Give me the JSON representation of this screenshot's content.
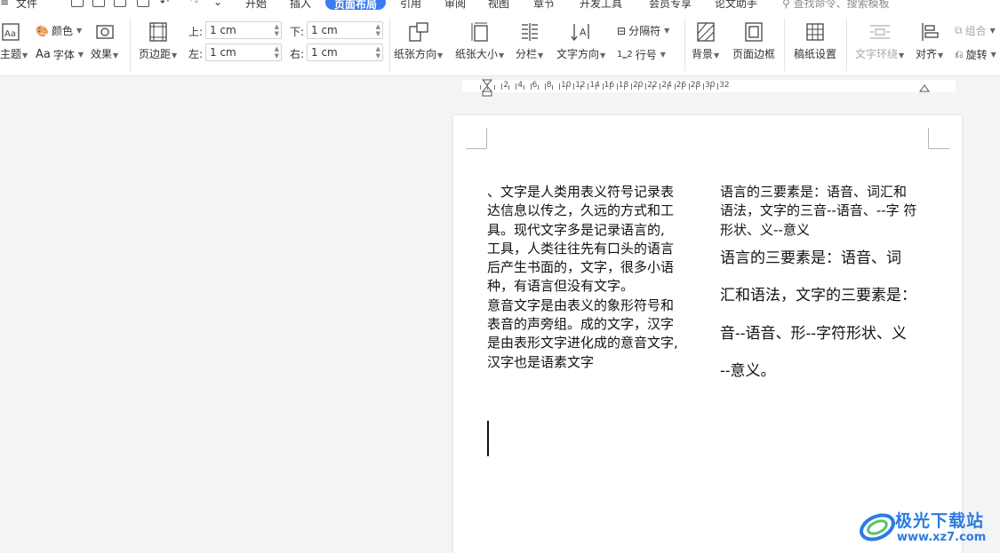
{
  "menubar": {
    "file": "文件",
    "tabs": [
      "开始",
      "插入",
      "页面布局",
      "引用",
      "审阅",
      "视图",
      "章节",
      "开发工具",
      "会员专享",
      "论文助手"
    ],
    "active_tab": "页面布局",
    "search_placeholder": "查找命令、搜索模板"
  },
  "ribbon": {
    "theme": "主题",
    "color": "颜色",
    "font": "字体",
    "effect": "效果",
    "margins": "页边距",
    "top_label": "上:",
    "top_value": "1 cm",
    "left_label": "左:",
    "left_value": "1 cm",
    "bottom_label": "下:",
    "bottom_value": "1 cm",
    "right_label": "右:",
    "right_value": "1 cm",
    "orientation": "纸张方向",
    "size": "纸张大小",
    "columns": "分栏",
    "text_direction": "文字方向",
    "separator": "分隔符",
    "line_number": "行号",
    "background": "背景",
    "page_border": "页面边框",
    "manuscript": "稿纸设置",
    "text_wrap": "文字环绕",
    "align": "对齐",
    "group": "组合",
    "rotate": "旋转"
  },
  "ruler": {
    "labels": [
      "2",
      "4",
      "6",
      "8",
      "10",
      "12",
      "14",
      "16",
      "18",
      "20",
      "22",
      "24",
      "26",
      "28",
      "30",
      "32"
    ]
  },
  "document": {
    "col1": [
      "、文字是人类用表义符号记录表",
      "达信息以传之，久远的方式和工",
      "具。现代文字多是记录语言的,",
      "工具，人类往往先有口头的语言",
      "后产生书面的，文字，很多小语",
      "种，有语言但没有文字。",
      "意音文字是由表义的象形符号和",
      "表音的声旁组。成的文字，汉字",
      "是由表形文字进化成的意音文字,",
      "汉字也是语素文字"
    ],
    "col2_small": [
      "语言的三要素是：语音、词汇和",
      "语法，文字的三音--语音、--字  符",
      "形状、义--意义"
    ],
    "col2_large": [
      "语言的三要素是：语音、词",
      "汇和语法，文字的三要素是：",
      "音--语音、形--字符形状、义",
      "--意义。"
    ]
  },
  "watermark": {
    "brand": "极光下载站",
    "url": "www.xz7.com"
  },
  "colors": {
    "accent": "#3a7bf0",
    "watermark": "#2d7be0"
  }
}
